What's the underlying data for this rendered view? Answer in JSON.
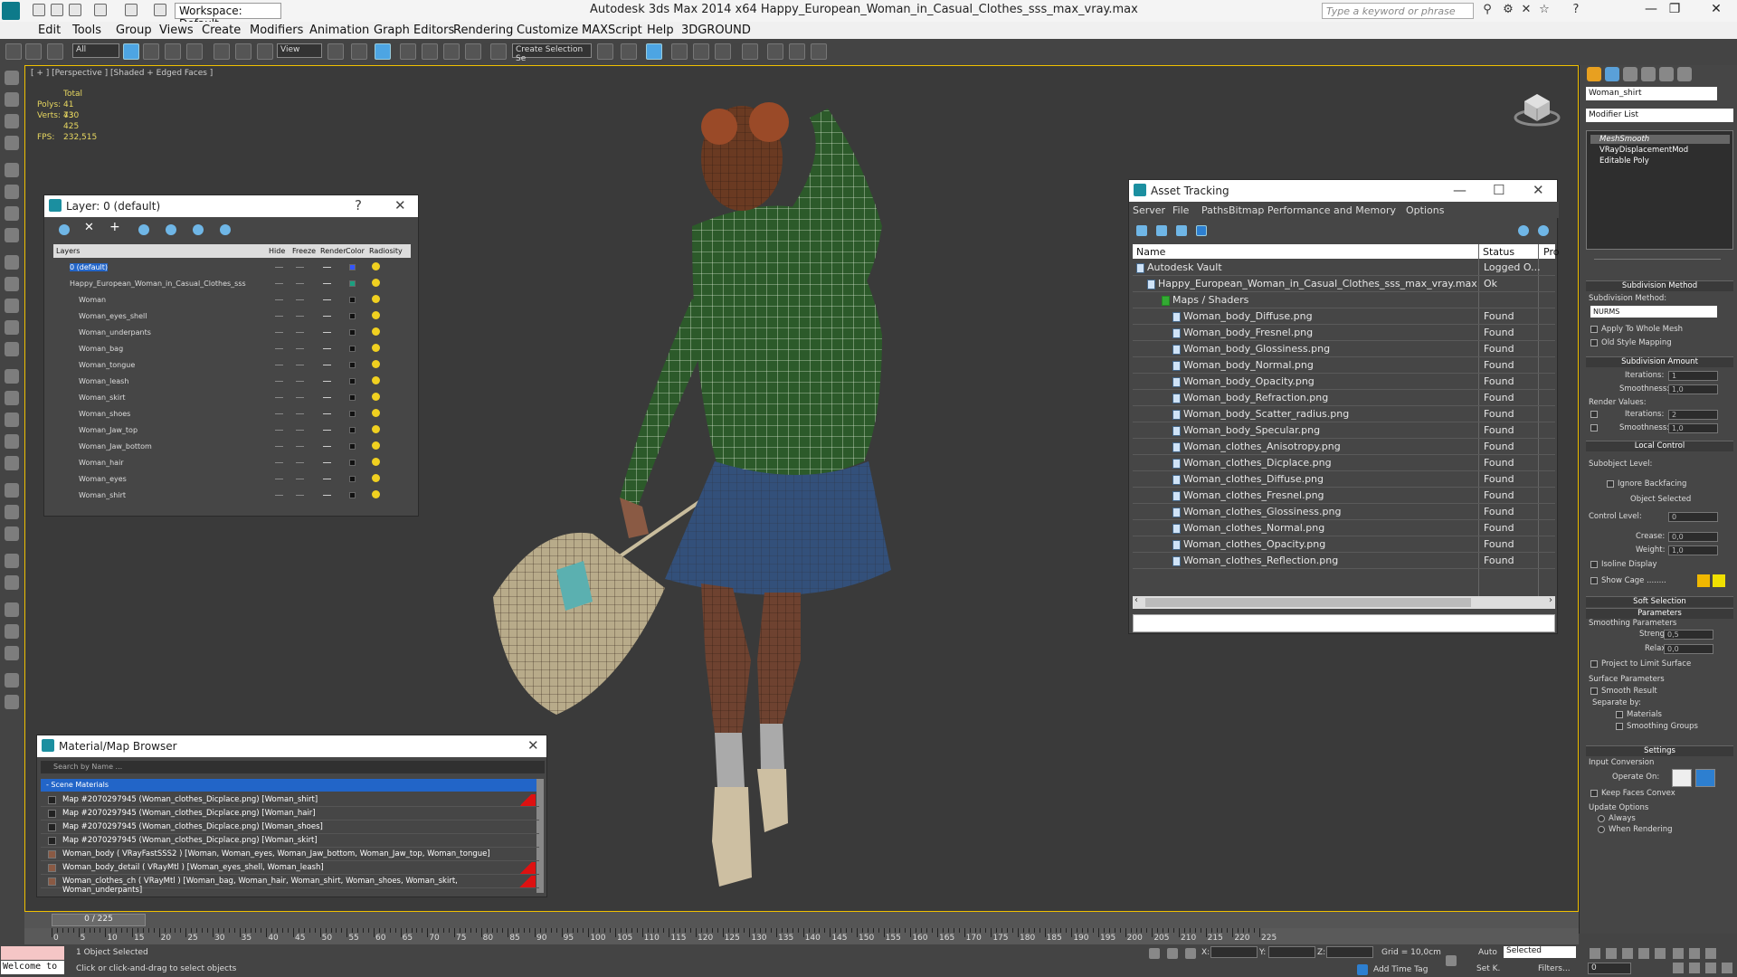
{
  "titlebar": {
    "workspace": "Workspace: Default",
    "title": "Autodesk 3ds Max  2014 x64     Happy_European_Woman_in_Casual_Clothes_sss_max_vray.max",
    "search_placeholder": "Type a keyword or phrase",
    "icons": [
      "new-icon",
      "open-icon",
      "save-icon",
      "undo-icon",
      "redo-icon",
      "project-icon",
      "binoculars-icon",
      "star-icon",
      "help-icon"
    ]
  },
  "menu": [
    "Edit",
    "Tools",
    "Group",
    "Views",
    "Create",
    "Modifiers",
    "Animation",
    "Graph Editors",
    "Rendering",
    "Customize",
    "MAXScript",
    "Help",
    "3DGROUND"
  ],
  "toolbar": {
    "filter": "All",
    "refcoord": "View",
    "selset": "Create Selection Se"
  },
  "viewport": {
    "label": "[ + ] [Perspective ] [Shaded + Edged Faces ]",
    "stats": {
      "total_label": "Total",
      "polys_label": "Polys:",
      "polys": "41 730",
      "verts_label": "Verts:",
      "verts": "43 425",
      "fps_label": "FPS:",
      "fps": "232,515"
    }
  },
  "layer_panel": {
    "title": "Layer: 0 (default)",
    "columns": [
      "Layers",
      "Hide",
      "Freeze",
      "Render",
      "Color",
      "Radiosity"
    ],
    "rows": [
      {
        "name": "0 (default)",
        "indent": 0,
        "color": "#3355ff",
        "selected": true
      },
      {
        "name": "Happy_European_Woman_in_Casual_Clothes_sss",
        "indent": 0,
        "color": "#1aa080"
      },
      {
        "name": "Woman",
        "indent": 1,
        "color": "#111111"
      },
      {
        "name": "Woman_eyes_shell",
        "indent": 1,
        "color": "#111111"
      },
      {
        "name": "Woman_underpants",
        "indent": 1,
        "color": "#111111"
      },
      {
        "name": "Woman_bag",
        "indent": 1,
        "color": "#111111"
      },
      {
        "name": "Woman_tongue",
        "indent": 1,
        "color": "#111111"
      },
      {
        "name": "Woman_leash",
        "indent": 1,
        "color": "#111111"
      },
      {
        "name": "Woman_skirt",
        "indent": 1,
        "color": "#111111"
      },
      {
        "name": "Woman_shoes",
        "indent": 1,
        "color": "#111111"
      },
      {
        "name": "Woman_Jaw_top",
        "indent": 1,
        "color": "#111111"
      },
      {
        "name": "Woman_Jaw_bottom",
        "indent": 1,
        "color": "#111111"
      },
      {
        "name": "Woman_hair",
        "indent": 1,
        "color": "#111111"
      },
      {
        "name": "Woman_eyes",
        "indent": 1,
        "color": "#111111"
      },
      {
        "name": "Woman_shirt",
        "indent": 1,
        "color": "#111111"
      }
    ]
  },
  "asset_panel": {
    "title": "Asset Tracking",
    "menu": [
      "Server",
      "File",
      "Paths",
      "Bitmap Performance and Memory",
      "Options"
    ],
    "columns": [
      "Name",
      "Status",
      "Pro"
    ],
    "rows": [
      {
        "name": "Autodesk Vault",
        "status": "Logged O...",
        "level": 0
      },
      {
        "name": "Happy_European_Woman_in_Casual_Clothes_sss_max_vray.max",
        "status": "Ok",
        "level": 1
      },
      {
        "name": "Maps / Shaders",
        "status": "",
        "level": 2
      },
      {
        "name": "Woman_body_Diffuse.png",
        "status": "Found",
        "level": 3
      },
      {
        "name": "Woman_body_Fresnel.png",
        "status": "Found",
        "level": 3
      },
      {
        "name": "Woman_body_Glossiness.png",
        "status": "Found",
        "level": 3
      },
      {
        "name": "Woman_body_Normal.png",
        "status": "Found",
        "level": 3
      },
      {
        "name": "Woman_body_Opacity.png",
        "status": "Found",
        "level": 3
      },
      {
        "name": "Woman_body_Refraction.png",
        "status": "Found",
        "level": 3
      },
      {
        "name": "Woman_body_Scatter_radius.png",
        "status": "Found",
        "level": 3
      },
      {
        "name": "Woman_body_Specular.png",
        "status": "Found",
        "level": 3
      },
      {
        "name": "Woman_clothes_Anisotropy.png",
        "status": "Found",
        "level": 3
      },
      {
        "name": "Woman_clothes_Dicplace.png",
        "status": "Found",
        "level": 3
      },
      {
        "name": "Woman_clothes_Diffuse.png",
        "status": "Found",
        "level": 3
      },
      {
        "name": "Woman_clothes_Fresnel.png",
        "status": "Found",
        "level": 3
      },
      {
        "name": "Woman_clothes_Glossiness.png",
        "status": "Found",
        "level": 3
      },
      {
        "name": "Woman_clothes_Normal.png",
        "status": "Found",
        "level": 3
      },
      {
        "name": "Woman_clothes_Opacity.png",
        "status": "Found",
        "level": 3
      },
      {
        "name": "Woman_clothes_Reflection.png",
        "status": "Found",
        "level": 3
      }
    ]
  },
  "material_panel": {
    "title": "Material/Map Browser",
    "search_placeholder": "Search by Name ...",
    "group": "- Scene Materials",
    "rows": [
      {
        "text": "Map #2070297945 (Woman_clothes_Dicplace.png) [Woman_shirt]",
        "red": true
      },
      {
        "text": "Map #2070297945 (Woman_clothes_Dicplace.png) [Woman_hair]",
        "red": false
      },
      {
        "text": "Map #2070297945 (Woman_clothes_Dicplace.png) [Woman_shoes]",
        "red": false
      },
      {
        "text": "Map #2070297945 (Woman_clothes_Dicplace.png) [Woman_skirt]",
        "red": false
      },
      {
        "text": "Woman_body  ( VRayFastSSS2 ) [Woman, Woman_eyes, Woman_Jaw_bottom, Woman_Jaw_top, Woman_tongue]",
        "red": false
      },
      {
        "text": "Woman_body_detail  ( VRayMtl ) [Woman_eyes_shell, Woman_leash]",
        "red": true
      },
      {
        "text": "Woman_clothes_ch  ( VRayMtl ) [Woman_bag, Woman_hair, Woman_shirt, Woman_shoes, Woman_skirt, Woman_underpants]",
        "red": true
      }
    ]
  },
  "command_panel": {
    "object_name": "Woman_shirt",
    "modifier_list": "Modifier List",
    "stack": [
      "MeshSmooth",
      "VRayDisplacementMod",
      "Editable Poly"
    ],
    "subdiv_method_title": "Subdivision Method",
    "subdiv_method_label": "Subdivision Method:",
    "subdiv_method": "NURMS",
    "apply_whole": "Apply To Whole Mesh",
    "old_style": "Old Style Mapping",
    "subdiv_amount_title": "Subdivision Amount",
    "iterations_label": "Iterations:",
    "iterations": "1",
    "smoothness_label": "Smoothness:",
    "smoothness": "1,0",
    "render_values": "Render Values:",
    "r_iterations": "2",
    "r_smoothness": "1,0",
    "local_control_title": "Local Control",
    "subobject_level": "Subobject Level:",
    "ignore_backfacing": "Ignore Backfacing",
    "object_selected": "Object Selected",
    "control_level": "Control Level:",
    "control_level_val": "0",
    "crease": "Crease:",
    "crease_val": "0,0",
    "weight": "Weight:",
    "weight_val": "1,0",
    "isoline": "Isoline Display",
    "show_cage": "Show Cage ........",
    "soft_selection": "Soft Selection",
    "parameters": "Parameters",
    "smoothing_params": "Smoothing Parameters",
    "strength": "Strength:",
    "strength_val": "0,5",
    "relax": "Relax:",
    "relax_val": "0,0",
    "project_limit": "Project to Limit Surface",
    "surface_params": "Surface Parameters",
    "smooth_result": "Smooth Result",
    "separate_by": "Separate by:",
    "materials": "Materials",
    "smoothing_groups": "Smoothing Groups",
    "settings": "Settings",
    "input_conversion": "Input Conversion",
    "operate_on": "Operate On:",
    "keep_faces": "Keep Faces Convex",
    "update_options": "Update Options",
    "always": "Always",
    "when_rendering": "When Rendering"
  },
  "timeline": {
    "frame": "0 / 225",
    "ticks": [
      "0",
      "5",
      "10",
      "15",
      "20",
      "25",
      "30",
      "35",
      "40",
      "45",
      "50",
      "55",
      "60",
      "65",
      "70",
      "75",
      "80",
      "85",
      "90",
      "95",
      "100",
      "105",
      "110",
      "115",
      "120",
      "125",
      "130",
      "135",
      "140",
      "145",
      "150",
      "155",
      "160",
      "165",
      "170",
      "175",
      "180",
      "185",
      "190",
      "195",
      "200",
      "205",
      "210",
      "215",
      "220",
      "225"
    ]
  },
  "status": {
    "welcome": "Welcome to",
    "selected_count": "1 Object Selected",
    "hint": "Click or click-and-drag to select objects",
    "x_label": "X:",
    "y_label": "Y:",
    "z_label": "Z:",
    "grid": "Grid = 10,0cm",
    "add_time_tag": "Add Time Tag",
    "auto": "Auto",
    "setk": "Set K.",
    "selected": "Selected",
    "filters": "Filters...",
    "frame_field": "0"
  }
}
